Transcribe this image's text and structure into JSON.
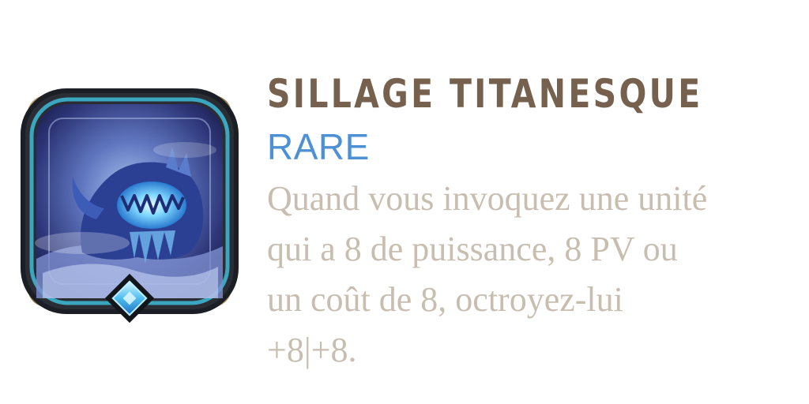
{
  "card": {
    "icon": "titan-wake-monster-icon",
    "title": "SILLAGE TITANESQUE",
    "rarity": "RARE",
    "description": "Quand vous invoquez une unité\nqui a 8 de puissance, 8 PV ou\nun coût de 8, octroyez-lui\n+8|+8."
  },
  "colors": {
    "title": "#75614d",
    "rarity": "#4d91d4",
    "description": "#c8beb0",
    "frame_gold": "#a08a5e",
    "frame_teal": "#3aa6c0",
    "gem": "#6fd3f5"
  }
}
